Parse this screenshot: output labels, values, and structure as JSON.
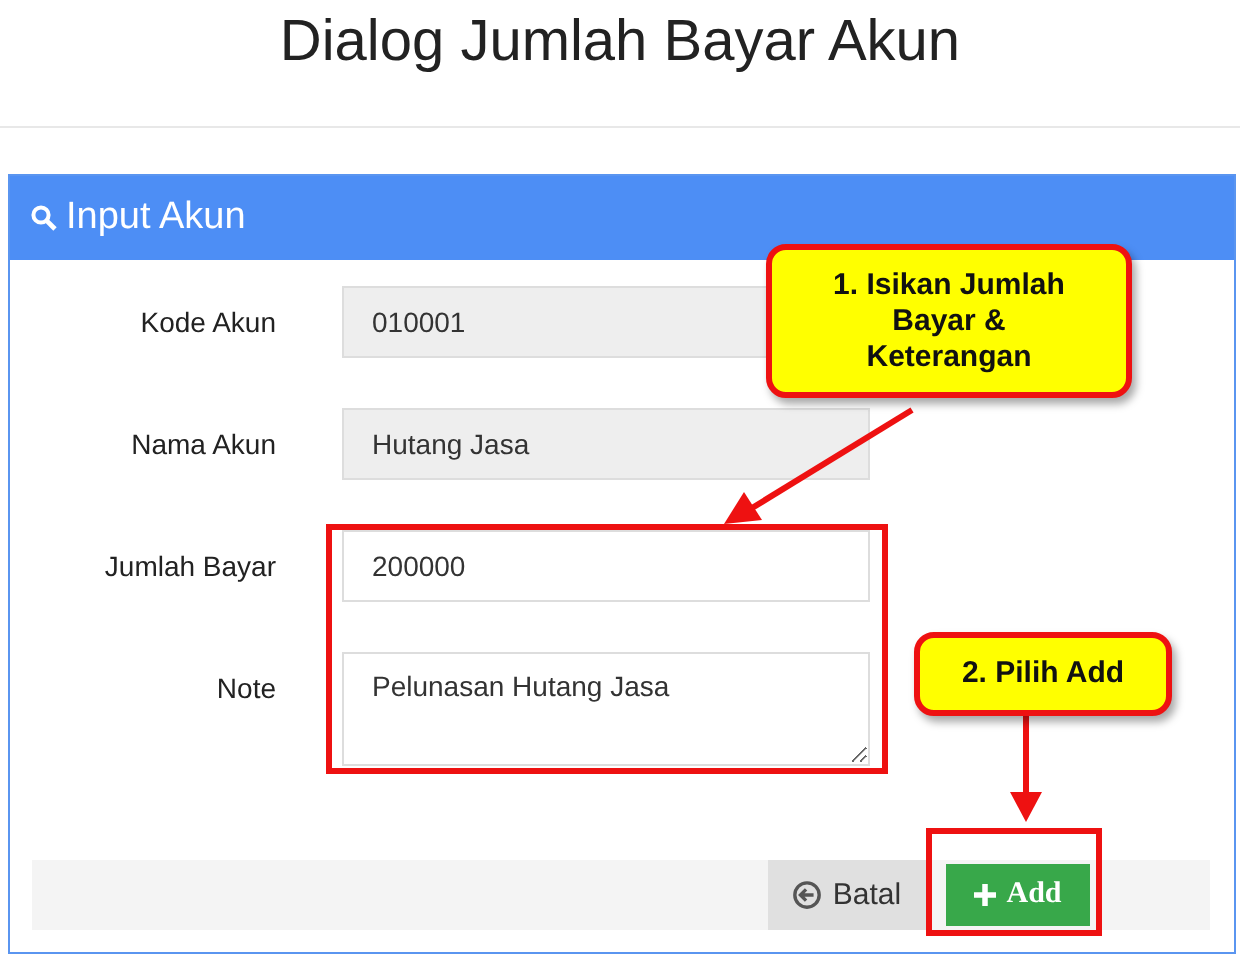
{
  "page_title": "Dialog Jumlah Bayar Akun",
  "panel": {
    "title": "Input Akun",
    "fields": [
      {
        "label": "Kode Akun",
        "value": "010001",
        "kind": "readonly"
      },
      {
        "label": "Nama Akun",
        "value": "Hutang Jasa",
        "kind": "readonly"
      },
      {
        "label": "Jumlah Bayar",
        "value": "200000",
        "kind": "input"
      },
      {
        "label": "Note",
        "value": "Pelunasan Hutang Jasa",
        "kind": "textarea"
      }
    ],
    "buttons": [
      {
        "label": "Batal",
        "kind": "cancel"
      },
      {
        "label": "Add",
        "kind": "add"
      }
    ]
  },
  "annotations": [
    {
      "text": "1. Isikan Jumlah Bayar & Keterangan"
    },
    {
      "text": "2. Pilih Add"
    }
  ]
}
